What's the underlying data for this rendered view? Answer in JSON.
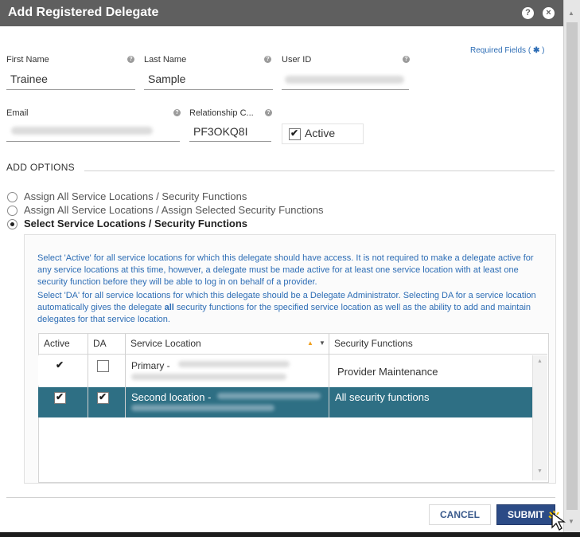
{
  "dialog": {
    "title": "Add Registered Delegate",
    "help_icon": "?",
    "close_icon": "×"
  },
  "required_fields": {
    "label": "Required Fields (",
    "star": "✱",
    "close": ")"
  },
  "form": {
    "first_name": {
      "label": "First Name",
      "value": "Trainee"
    },
    "last_name": {
      "label": "Last Name",
      "value": "Sample"
    },
    "user_id": {
      "label": "User ID",
      "value": ""
    },
    "email": {
      "label": "Email",
      "value": ""
    },
    "relationship_code": {
      "label": "Relationship C...",
      "value": "PF3OKQ8I"
    },
    "active": {
      "label": "Active",
      "checked": true
    }
  },
  "add_options": {
    "heading": "ADD OPTIONS",
    "options": [
      {
        "label": "Assign All Service Locations / Security Functions",
        "selected": false
      },
      {
        "label": "Assign All Service Locations / Assign Selected Security Functions",
        "selected": false
      },
      {
        "label": "Select Service Locations / Security Functions",
        "selected": true
      }
    ]
  },
  "info": {
    "para1": "Select 'Active' for all service locations for which this delegate should have access. It is not required to make a delegate active for any service locations at this time, however, a delegate must be made active for at least one service location with at least one security function before they will be able to log in on behalf of a provider.",
    "para2_a": "Select 'DA' for all service locations for which this delegate should be a Delegate Administrator. Selecting DA for a service location automatically gives the delegate ",
    "para2_bold": "all",
    "para2_b": " security functions for the specified service location as well as the ability to add and maintain delegates for that service location."
  },
  "grid": {
    "columns": {
      "active": "Active",
      "da": "DA",
      "location": "Service Location",
      "functions": "Security Functions"
    },
    "sort_icon": "▲",
    "filter_icon": "▼",
    "rows": [
      {
        "active": true,
        "da": false,
        "location": "Primary -",
        "functions": "Provider Maintenance",
        "selected": false
      },
      {
        "active": true,
        "da": true,
        "location": "Second location -",
        "functions": "All security functions",
        "selected": true
      }
    ]
  },
  "buttons": {
    "cancel": "CANCEL",
    "submit": "SUBMIT"
  },
  "colors": {
    "titlebar": "#5f5f5f",
    "accent_blue": "#2d6db5",
    "selected_row": "#2e6f84",
    "submit": "#2c4b86"
  }
}
